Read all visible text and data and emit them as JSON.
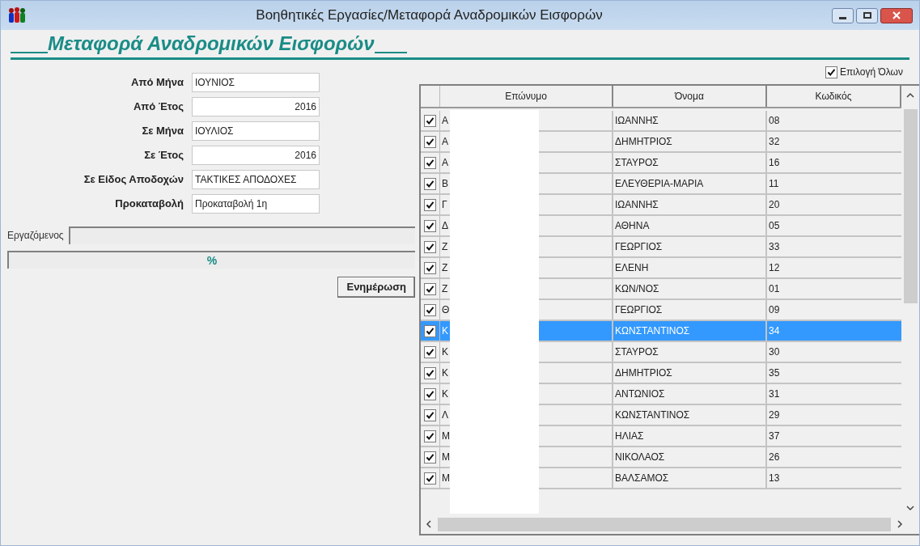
{
  "window": {
    "title": "Βοηθητικές Εργασίες/Μεταφορά Αναδρομικών Εισφορών"
  },
  "header": {
    "title": "Μεταφορά Αναδρομικών Εισφορών"
  },
  "form": {
    "fields": [
      {
        "label": "Από Μήνα",
        "value": "ΙΟΥΝΙΟΣ",
        "kind": "text"
      },
      {
        "label": "Από Έτος",
        "value": "2016",
        "kind": "number"
      },
      {
        "label": "Σε Μήνα",
        "value": "ΙΟΥΛΙΟΣ",
        "kind": "text"
      },
      {
        "label": "Σε Έτος",
        "value": "2016",
        "kind": "number"
      },
      {
        "label": "Σε Είδος Αποδοχών",
        "value": "ΤΑΚΤΙΚΕΣ ΑΠΟΔΟΧΕΣ",
        "kind": "text"
      },
      {
        "label": "Προκαταβολή",
        "value": "Προκαταβολή 1η",
        "kind": "text"
      }
    ],
    "employee_label": "Εργαζόμενος",
    "progress_text": "%",
    "progress": {
      "level": 0
    },
    "update_button": "Ενημέρωση"
  },
  "select_all": {
    "label": "Επιλογή Όλων",
    "checked": true
  },
  "table": {
    "columns": [
      "Επώνυμο",
      "Όνομα",
      "Κωδικός"
    ],
    "rows": [
      {
        "checked": true,
        "surname": "Α",
        "name": "ΙΩΑΝΝΗΣ",
        "code": "08",
        "selected": false
      },
      {
        "checked": true,
        "surname": "Α",
        "name": "ΔΗΜΗΤΡΙΟΣ",
        "code": "32",
        "selected": false
      },
      {
        "checked": true,
        "surname": "Α",
        "name": "ΣΤΑΥΡΟΣ",
        "code": "16",
        "selected": false
      },
      {
        "checked": true,
        "surname": "Β",
        "name": "ΕΛΕΥΘΕΡΙΑ-ΜΑΡΙΑ",
        "code": "11",
        "selected": false
      },
      {
        "checked": true,
        "surname": "Γ",
        "name": "ΙΩΑΝΝΗΣ",
        "code": "20",
        "selected": false
      },
      {
        "checked": true,
        "surname": "Δ",
        "name": "ΑΘΗΝΑ",
        "code": "05",
        "selected": false
      },
      {
        "checked": true,
        "surname": "Ζ",
        "name": "ΓΕΩΡΓΙΟΣ",
        "code": "33",
        "selected": false
      },
      {
        "checked": true,
        "surname": "Ζ",
        "name": "ΕΛΕΝΗ",
        "code": "12",
        "selected": false
      },
      {
        "checked": true,
        "surname": "Ζ",
        "name": "ΚΩΝ/ΝΟΣ",
        "code": "01",
        "selected": false
      },
      {
        "checked": true,
        "surname": "Θ",
        "name": "ΓΕΩΡΓΙΟΣ",
        "code": "09",
        "selected": false
      },
      {
        "checked": true,
        "surname": "Κ",
        "name": "ΚΩΝΣΤΑΝΤΙΝΟΣ",
        "code": "34",
        "selected": true
      },
      {
        "checked": true,
        "surname": "Κ",
        "name": "ΣΤΑΥΡΟΣ",
        "code": "30",
        "selected": false
      },
      {
        "checked": true,
        "surname": "Κ",
        "name": "ΔΗΜΗΤΡΙΟΣ",
        "code": "35",
        "selected": false
      },
      {
        "checked": true,
        "surname": "Κ",
        "name": "ΑΝΤΩΝΙΟΣ",
        "code": "31",
        "selected": false
      },
      {
        "checked": true,
        "surname": "Λ",
        "name": "ΚΩΝΣΤΑΝΤΙΝΟΣ",
        "code": "29",
        "selected": false
      },
      {
        "checked": true,
        "surname": "Μ",
        "name": "ΗΛΙΑΣ",
        "code": "37",
        "selected": false
      },
      {
        "checked": true,
        "surname": "Μ",
        "name": "ΝΙΚΟΛΑΟΣ",
        "code": "26",
        "selected": false
      },
      {
        "checked": true,
        "surname": "Μ",
        "name": "ΒΑΛΣΑΜΟΣ",
        "code": "13",
        "selected": false
      }
    ]
  }
}
